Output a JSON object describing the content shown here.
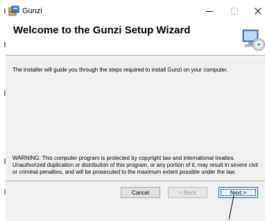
{
  "window": {
    "title": "Gunzi",
    "icons": {
      "app": "installer-package-icon",
      "minimize": "minimize-icon",
      "maximize": "maximize-icon",
      "close": "close-icon"
    }
  },
  "header": {
    "title": "Welcome to the Gunzi Setup Wizard",
    "icon": "computer-disc-icon"
  },
  "body": {
    "intro": "The installer will guide you through the steps required to install Gunzi on your computer.",
    "warning": "WARNING: This computer program is protected by copyright law and international treaties. Unauthorized duplication or distribution of this program, or any portion of it, may result in severe civil or criminal penalties, and will be prosecuted to the maximum extent possible under the law."
  },
  "buttons": {
    "cancel": "Cancel",
    "back": "< Back",
    "next": "Next >",
    "back_enabled": false,
    "default_button": "next"
  },
  "colors": {
    "accent": "#0078d7",
    "dialog_bg": "#f0f0f0",
    "header_bg": "#ffffff",
    "disabled_text": "#a0a0a0"
  }
}
